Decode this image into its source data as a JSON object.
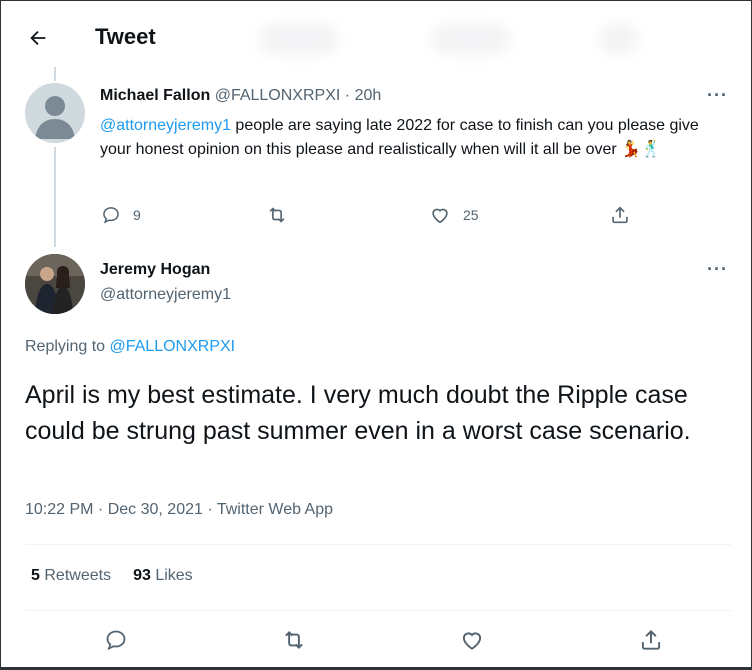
{
  "header": {
    "title": "Tweet"
  },
  "parent_tweet": {
    "display_name": "Michael Fallon",
    "handle": "@FALLONXRPXI",
    "separator": "·",
    "time": "20h",
    "mention": "@attorneyjeremy1",
    "text": " people are saying late 2022 for case to finish can you please give your honest opinion on this please and realistically when will it all be over 💃🕺",
    "replies": "9",
    "retweets": "",
    "likes": "25"
  },
  "main_tweet": {
    "display_name": "Jeremy Hogan",
    "handle": "@attorneyjeremy1",
    "replying_prefix": "Replying to ",
    "replying_to": "@FALLONXRPXI",
    "text": "April is my best estimate.  I very much doubt the Ripple case could be strung past summer even in a worst case scenario.",
    "meta": "10:22 PM · Dec 30, 2021 · Twitter Web App",
    "retweets_count": "5",
    "retweets_label": "Retweets",
    "likes_count": "93",
    "likes_label": "Likes"
  },
  "icons": {
    "back": "arrow-left-icon",
    "more": "more-horizontal-icon",
    "reply": "reply-icon",
    "retweet": "retweet-icon",
    "like": "heart-icon",
    "share": "share-icon"
  },
  "colors": {
    "accent": "#1d9bf0",
    "text": "#0f1419",
    "secondary": "#536471",
    "divider": "#eff3f4"
  }
}
